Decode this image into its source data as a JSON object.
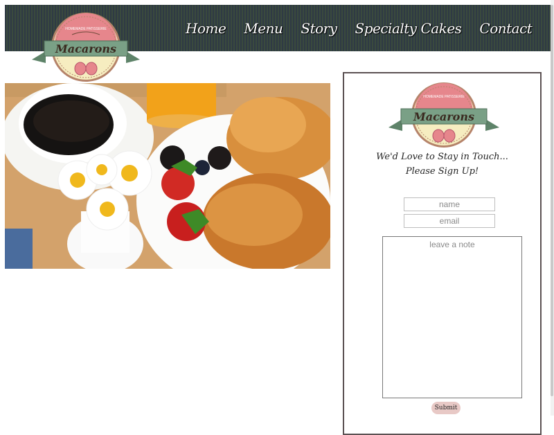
{
  "brand": {
    "logo_text": "Macarons",
    "logo_tagline": "HOMEMADE PATISSERIE"
  },
  "nav": {
    "items": [
      {
        "label": "Home"
      },
      {
        "label": "Menu"
      },
      {
        "label": "Story"
      },
      {
        "label": "Specialty Cakes"
      },
      {
        "label": "Contact"
      }
    ]
  },
  "hero": {
    "image_name": "breakfast-tray-photo"
  },
  "signup": {
    "logo_text": "Macarons",
    "title_line1": "We'd Love to Stay in Touch...",
    "title_line2": "Please Sign Up!",
    "name_placeholder": "name",
    "email_placeholder": "email",
    "note_placeholder": "leave a note",
    "submit_label": "Submit"
  },
  "colors": {
    "header_stripes": "#2f3a44",
    "logo_pink": "#e6868c",
    "logo_ribbon": "#7aa086",
    "logo_cream": "#f6edc0",
    "submit_bg": "#e8c9c6"
  }
}
